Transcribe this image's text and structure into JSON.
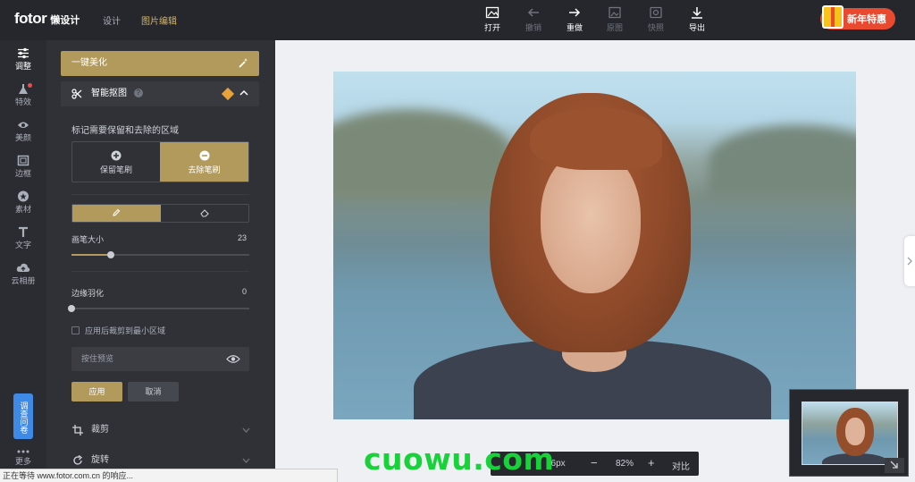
{
  "topbar": {
    "brand": "fotor",
    "brand_sub": "懒设计",
    "nav_design": "设计",
    "nav_edit": "图片编辑",
    "tools": [
      {
        "label": "打开",
        "icon": "open-image-icon",
        "enabled": true
      },
      {
        "label": "撤销",
        "icon": "undo-arrow-icon",
        "enabled": false
      },
      {
        "label": "重做",
        "icon": "redo-arrow-icon",
        "enabled": true
      },
      {
        "label": "原图",
        "icon": "original-image-icon",
        "enabled": false
      },
      {
        "label": "快照",
        "icon": "snapshot-icon",
        "enabled": false
      },
      {
        "label": "导出",
        "icon": "download-icon",
        "enabled": true
      }
    ],
    "promo": "新年特惠"
  },
  "rail": {
    "items": [
      {
        "label": "调整",
        "icon": "sliders-icon",
        "active": true
      },
      {
        "label": "特效",
        "icon": "flask-icon",
        "active": false
      },
      {
        "label": "美颜",
        "icon": "eye-icon",
        "active": false
      },
      {
        "label": "边框",
        "icon": "frame-icon",
        "active": false
      },
      {
        "label": "素材",
        "icon": "star-icon",
        "active": false
      },
      {
        "label": "文字",
        "icon": "text-icon",
        "active": false
      },
      {
        "label": "云相册",
        "icon": "cloud-upload-icon",
        "active": false
      },
      {
        "label": "更多",
        "icon": "more-dots-icon",
        "active": false
      }
    ],
    "survey": "调查问卷"
  },
  "panel": {
    "one_click": "一键美化",
    "cutout_title": "智能抠图",
    "mark_hint": "标记需要保留和去除的区域",
    "keep_brush": "保留笔刷",
    "remove_brush": "去除笔刷",
    "brush_size_label": "画笔大小",
    "brush_size_value": "23",
    "brush_size_fraction": 0.22,
    "feather_label": "边缘羽化",
    "feather_value": "0",
    "crop_checkbox": "应用后裁剪到最小区域",
    "preview_label": "按住预览",
    "apply": "应用",
    "cancel": "取消",
    "crop": "裁剪",
    "rotate": "旋转"
  },
  "zoombar": {
    "size": "66px",
    "zoom": "82%",
    "compare": "对比"
  },
  "status": "正在等待 www.fotor.com.cn 的响应...",
  "watermark": "cuowu.com",
  "colors": {
    "accent": "#b19a5c",
    "topbar_bg": "#25272c",
    "panel_bg": "#2f3136",
    "promo": "#e8492f",
    "watermark": "#18d23a"
  }
}
